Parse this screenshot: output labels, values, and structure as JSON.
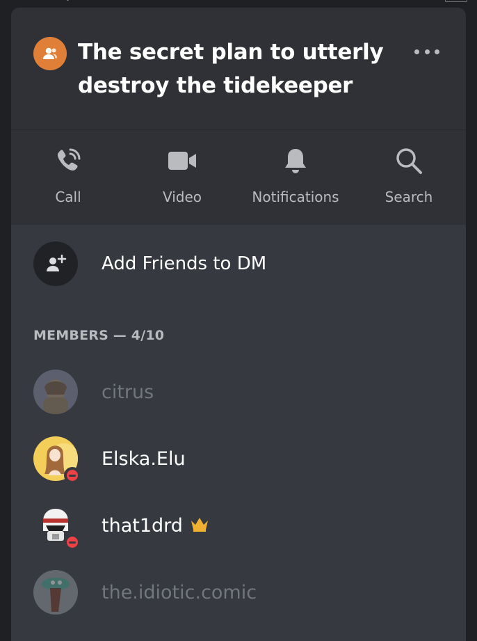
{
  "header": {
    "title": "The secret plan to utterly destroy the tidekeeper"
  },
  "actions": [
    {
      "label": "Call",
      "icon": "phone-call-icon"
    },
    {
      "label": "Video",
      "icon": "video-camera-icon"
    },
    {
      "label": "Notifications",
      "icon": "bell-icon"
    },
    {
      "label": "Search",
      "icon": "magnifier-icon"
    }
  ],
  "add_friends": {
    "label": "Add Friends to DM",
    "icon": "add-user-icon"
  },
  "members": {
    "heading": "MEMBERS — 4/10",
    "list": [
      {
        "name": "citrus",
        "status": "offline"
      },
      {
        "name": "Elska.Elu",
        "status": "do-not-disturb"
      },
      {
        "name": "that1drd",
        "status": "do-not-disturb",
        "owner": true
      },
      {
        "name": "the.idiotic.comic",
        "status": "offline"
      }
    ]
  },
  "colors": {
    "group_icon": "#e08038",
    "background": "#36393f",
    "header_bg": "#2f3136",
    "dnd": "#ed4245",
    "crown": "#f0b132"
  }
}
